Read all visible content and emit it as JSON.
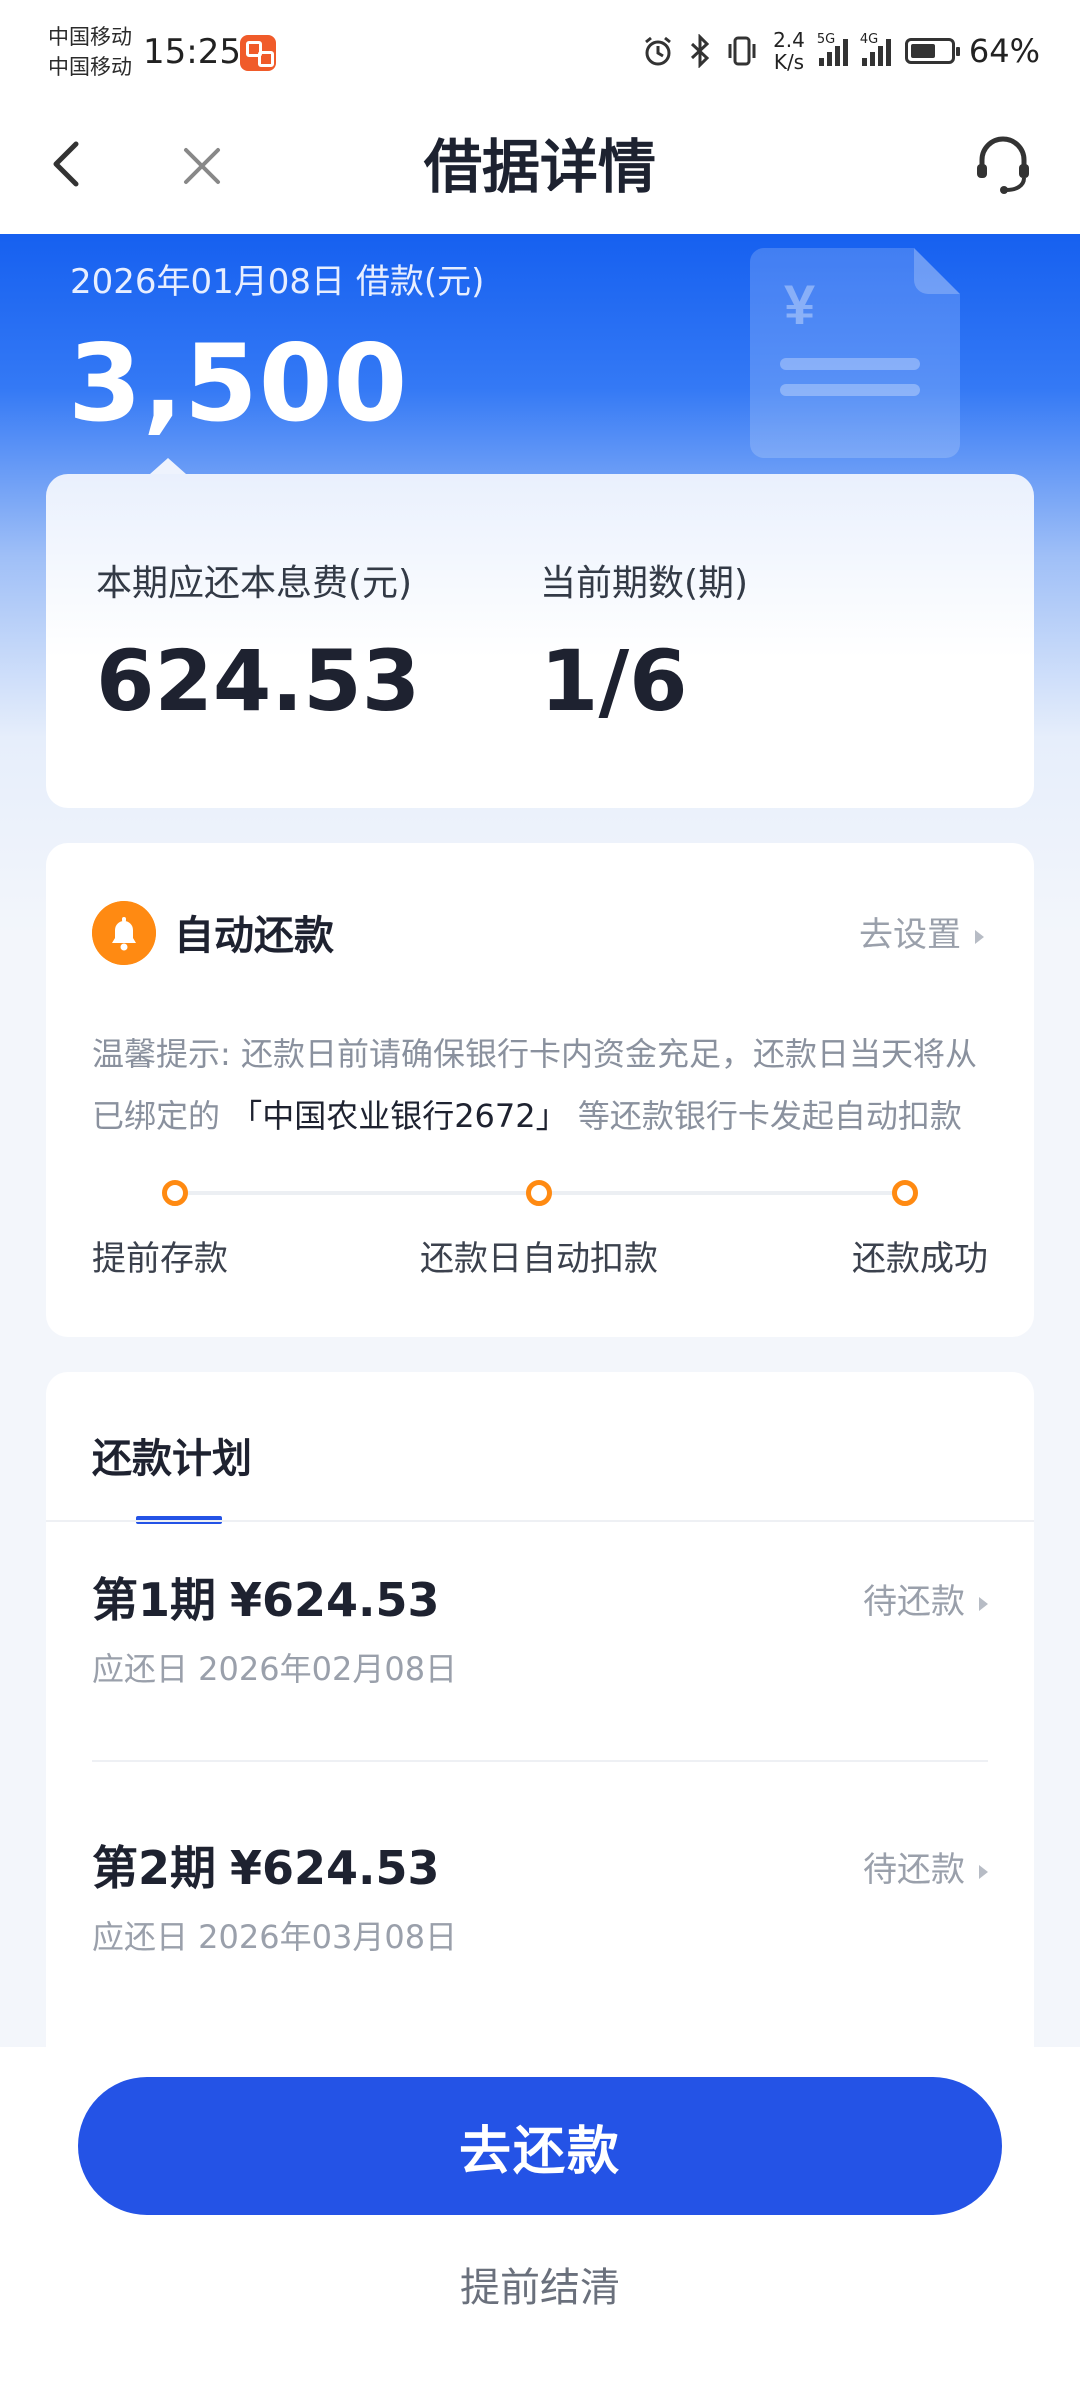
{
  "status_bar": {
    "carrier1": "中国移动",
    "carrier2": "中国移动",
    "time": "15:25",
    "speed_value": "2.4",
    "speed_unit": "K/s",
    "net1": "5G",
    "net2": "4G",
    "battery": "64%",
    "battery_level": 0.64
  },
  "nav": {
    "title": "借据详情"
  },
  "hero": {
    "date_label": "2026年01月08日 借款(元)",
    "amount": "3,500"
  },
  "summary": {
    "due_label": "本期应还本息费(元)",
    "due_value": "624.53",
    "period_label": "当前期数(期)",
    "period_value": "1/6"
  },
  "auto_repay": {
    "title": "自动还款",
    "setting_link": "去设置",
    "tip_prefix": "温馨提示: 还款日前请确保银行卡内资金充足，还款日当天将从已绑定的",
    "bank": "「中国农业银行2672」",
    "tip_suffix": "等还款银行卡发起自动扣款",
    "steps": [
      "提前存款",
      "还款日自动扣款",
      "还款成功"
    ],
    "accent_color": "#ff8a12"
  },
  "plan": {
    "tab_label": "还款计划",
    "rows": [
      {
        "period": "第1期",
        "amount": "¥624.53",
        "due": "应还日 2026年02月08日",
        "status": "待还款"
      },
      {
        "period": "第2期",
        "amount": "¥624.53",
        "due": "应还日 2026年03月08日",
        "status": "待还款"
      }
    ]
  },
  "actions": {
    "repay_button": "去还款",
    "settle_link": "提前结清",
    "primary_color": "#2453e6"
  }
}
